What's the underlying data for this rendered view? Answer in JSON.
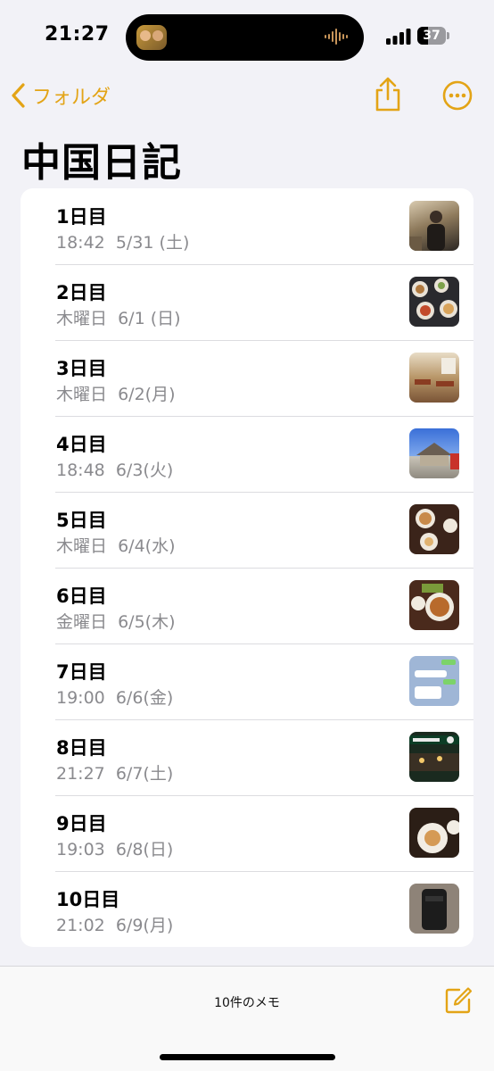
{
  "status_bar": {
    "time": "21:27",
    "battery": "37"
  },
  "nav": {
    "back_label": "フォルダ",
    "accent_color": "#e3a416"
  },
  "title": "中国日記",
  "notes": [
    {
      "title": "1日目",
      "meta": "18:42  5/31 (土)"
    },
    {
      "title": "2日目",
      "meta": "木曜日  6/1 (日)"
    },
    {
      "title": "3日目",
      "meta": "木曜日  6/2(月)"
    },
    {
      "title": "4日目",
      "meta": "18:48  6/3(火)"
    },
    {
      "title": "5日目",
      "meta": "木曜日  6/4(水)"
    },
    {
      "title": "6日目",
      "meta": "金曜日  6/5(木)"
    },
    {
      "title": "7日目",
      "meta": "19:00  6/6(金)"
    },
    {
      "title": "8日目",
      "meta": "21:27  6/7(土)"
    },
    {
      "title": "9日目",
      "meta": "19:03  6/8(日)"
    },
    {
      "title": "10日目",
      "meta": "21:02  6/9(月)"
    }
  ],
  "toolbar": {
    "note_count": "10件のメモ"
  },
  "icons": {
    "back": "chevron-left-icon",
    "share": "share-icon",
    "more": "ellipsis-circle-icon",
    "compose": "compose-icon"
  }
}
